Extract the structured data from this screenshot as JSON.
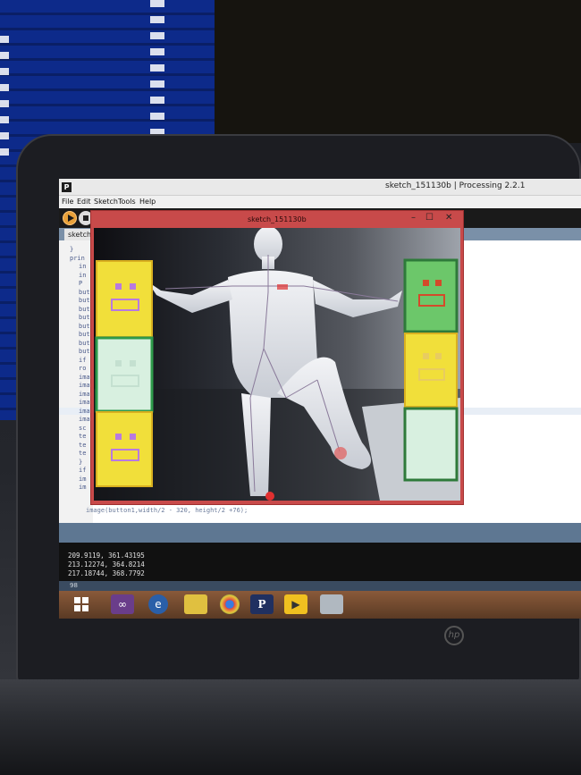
{
  "window": {
    "title": "sketch_151130b | Processing 2.2.1",
    "app_icon": "P"
  },
  "menu": [
    "File",
    "Edit",
    "Sketch",
    "Tools",
    "Help"
  ],
  "tab": {
    "label": "sketch"
  },
  "code": {
    "fragments": [
      "}",
      "prin",
      "in",
      "in",
      "P",
      "but",
      "but",
      "but",
      "but",
      "but",
      "but",
      "but",
      "but",
      "if",
      "ro",
      "ima",
      "ima",
      "ima",
      "ima",
      "ima",
      "ima",
      "sc",
      "te",
      "te",
      "te",
      "}",
      "if",
      "im",
      "im"
    ],
    "last_line": "image(button1,width/2 - 320, height/2 +76);"
  },
  "console": {
    "lines": [
      "209.9119, 361.43195",
      "213.12274, 364.8214",
      "217.18744, 368.7792"
    ]
  },
  "status": {
    "line_number": "98"
  },
  "sketch_window": {
    "title": "sketch_151130b",
    "controls": [
      "–",
      "☐",
      "✕"
    ]
  },
  "taskbar": {
    "icons": [
      "windows-start-icon",
      "visual-studio-icon",
      "internet-explorer-icon",
      "file-explorer-icon",
      "chrome-icon",
      "processing-icon",
      "media-player-icon",
      "window-icon"
    ],
    "processing_label": "P"
  },
  "colors": {
    "sketch_border": "#c84a4a",
    "yellow_box": "#f1df3a",
    "green_box": "#2e9a4a",
    "light_green_fill": "#d8f0e0",
    "face_stroke": "#b87adf",
    "face_stroke_red": "#d44a2a",
    "joint_red": "#e03030",
    "run_button": "#e8a13a"
  }
}
